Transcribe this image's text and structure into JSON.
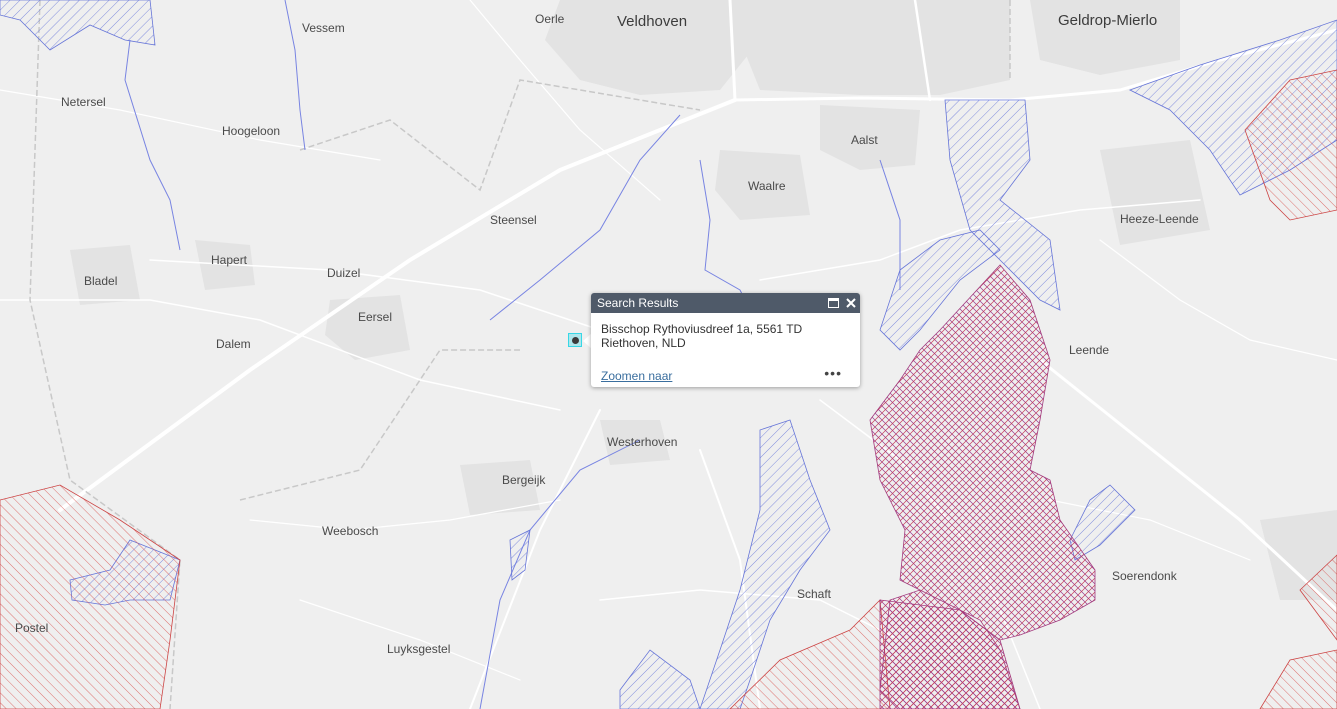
{
  "map": {
    "places": {
      "veldhoven": "Veldhoven",
      "geldrop_mierlo": "Geldrop-Mierlo",
      "oerle": "Oerle",
      "vessem": "Vessem",
      "netersel": "Netersel",
      "hoogeloon": "Hoogeloon",
      "aalst": "Aalst",
      "waalre": "Waalre",
      "steensel": "Steensel",
      "heeze_leende": "Heeze-Leende",
      "hapert": "Hapert",
      "duizel": "Duizel",
      "bladel": "Bladel",
      "eersel": "Eersel",
      "dalem": "Dalem",
      "leende": "Leende",
      "westerhoven": "Westerhoven",
      "bergeijk": "Bergeijk",
      "weebosch": "Weebosch",
      "soerendonk": "Soerendonk",
      "schaft": "Schaft",
      "postel": "Postel",
      "luyksgestel": "Luyksgestel"
    },
    "colors": {
      "background": "#efefef",
      "blue_hatch": "#5a6fd6",
      "red_hatch": "#d9534f",
      "water": "#6f7fe0"
    }
  },
  "popup": {
    "title": "Search Results",
    "address_line1": "Bisschop Rythoviusdreef 1a, 5561 TD",
    "address_line2": "Riethoven, NLD",
    "zoom_link": "Zoomen naar",
    "more_label": "•••",
    "header_color": "#4f5a69"
  }
}
